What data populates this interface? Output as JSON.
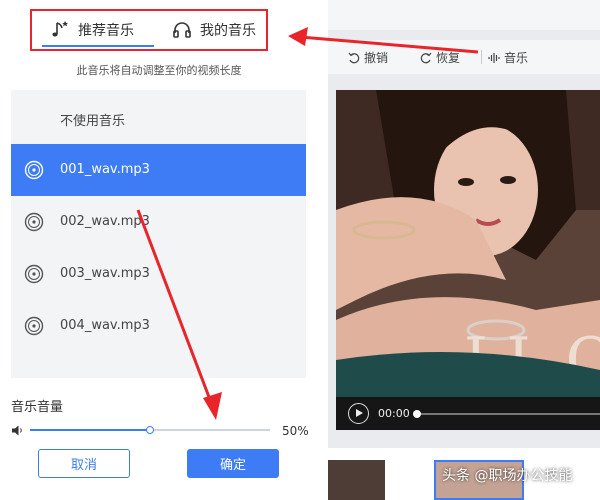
{
  "tabs": {
    "recommended": "推荐音乐",
    "mine": "我的音乐"
  },
  "hint": "此音乐将自动调整至你的视频长度",
  "music_list": [
    {
      "label": "不使用音乐",
      "has_icon": false,
      "selected": false
    },
    {
      "label": "001_wav.mp3",
      "has_icon": true,
      "selected": true
    },
    {
      "label": "002_wav.mp3",
      "has_icon": true,
      "selected": false
    },
    {
      "label": "003_wav.mp3",
      "has_icon": true,
      "selected": false
    },
    {
      "label": "004_wav.mp3",
      "has_icon": true,
      "selected": false
    }
  ],
  "volume": {
    "label": "音乐音量",
    "value_text": "50%",
    "level": 0.5
  },
  "buttons": {
    "cancel": "取消",
    "confirm": "确定"
  },
  "toolbar": {
    "undo": "撤销",
    "redo": "恢复",
    "music": "音乐"
  },
  "player": {
    "time": "00:00"
  },
  "watermark": "头条 @职场办公技能",
  "colors": {
    "accent": "#3d7cf5",
    "annotation": "#e8252b"
  },
  "icons": {
    "recommended_tab": "music-note-icon",
    "mine_tab": "headphones-icon",
    "list_item": "disc-icon",
    "volume": "speaker-icon",
    "undo": "undo-icon",
    "redo": "redo-icon",
    "music": "waveform-icon",
    "play": "play-icon"
  }
}
